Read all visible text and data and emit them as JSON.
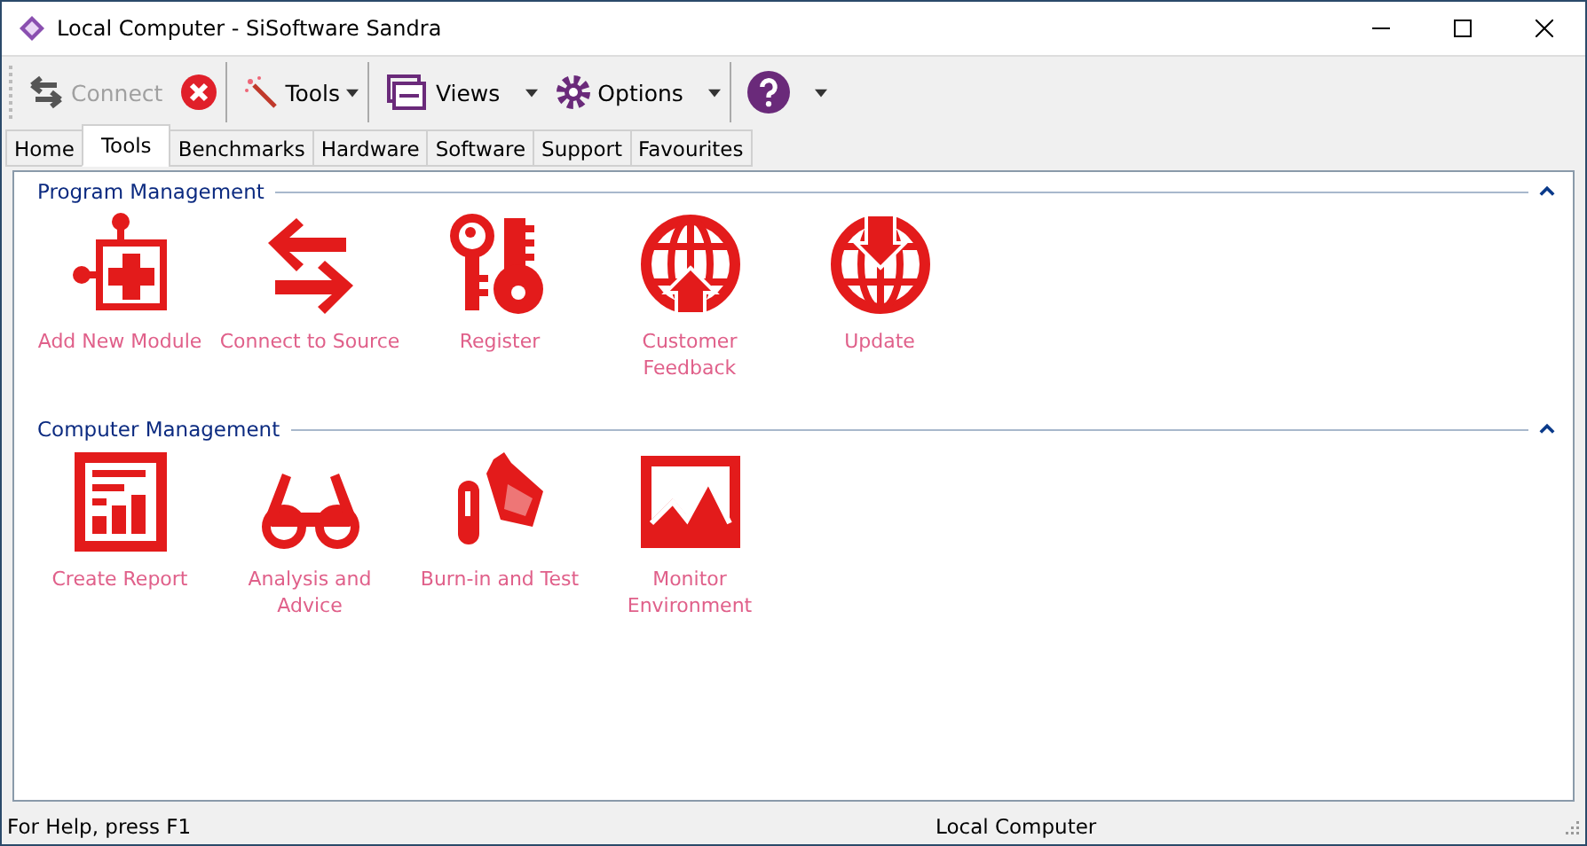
{
  "window": {
    "title": "Local Computer - SiSoftware Sandra"
  },
  "toolbar": [
    {
      "kind": "connect",
      "label": "Connect",
      "disabled": true
    },
    {
      "kind": "stop"
    },
    {
      "kind": "tools",
      "label": "Tools"
    },
    {
      "kind": "views",
      "label": "Views"
    },
    {
      "kind": "options",
      "label": "Options"
    },
    {
      "kind": "help"
    }
  ],
  "tabs": [
    {
      "label": "Home",
      "selected": false
    },
    {
      "label": "Tools",
      "selected": true
    },
    {
      "label": "Benchmarks",
      "selected": false
    },
    {
      "label": "Hardware",
      "selected": false
    },
    {
      "label": "Software",
      "selected": false
    },
    {
      "label": "Support",
      "selected": false
    },
    {
      "label": "Favourites",
      "selected": false
    }
  ],
  "sections": [
    {
      "title": "Program Management",
      "expanded": true,
      "items": [
        {
          "label": "Add New Module"
        },
        {
          "label": "Connect to Source"
        },
        {
          "label": "Register"
        },
        {
          "label": "Customer Feedback"
        },
        {
          "label": "Update"
        }
      ]
    },
    {
      "title": "Computer Management",
      "expanded": true,
      "items": [
        {
          "label": "Create Report"
        },
        {
          "label": "Analysis and Advice"
        },
        {
          "label": "Burn-in and Test"
        },
        {
          "label": "Monitor Environment"
        }
      ]
    }
  ],
  "status_bar": [
    "For Help, press F1",
    "Local Computer"
  ]
}
